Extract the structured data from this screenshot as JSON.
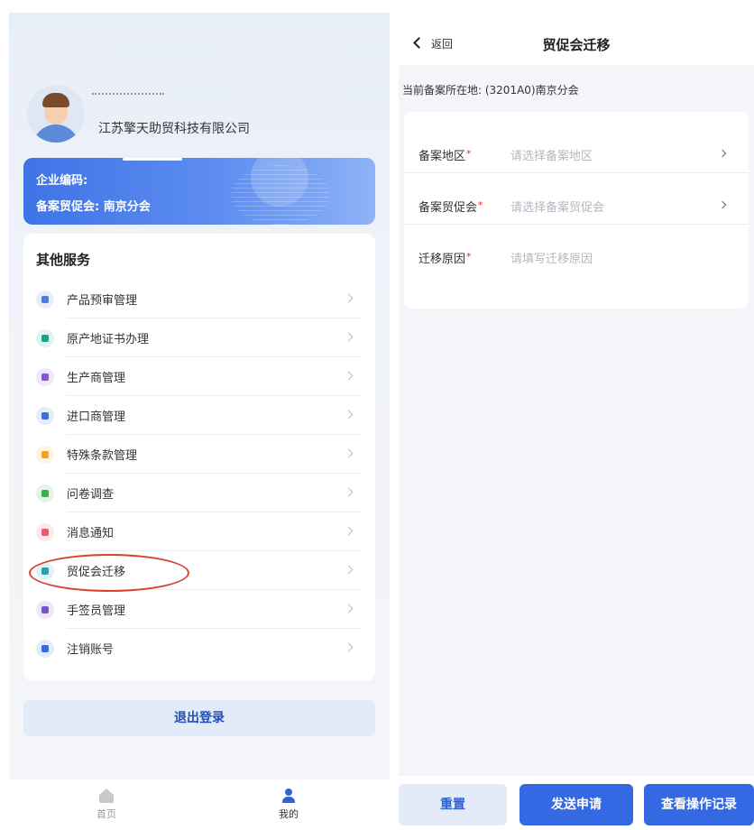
{
  "left": {
    "company_name": "江苏擎天助贸科技有限公司",
    "enterprise_card": {
      "code_label": "企业编码:",
      "coc_label": "备案贸促会: 南京分会"
    },
    "services": {
      "title": "其他服务",
      "items": [
        {
          "label": "产品预审管理",
          "icon": "cart-icon",
          "color": "#4f7be0"
        },
        {
          "label": "原产地证书办理",
          "icon": "location-pin-icon",
          "color": "#1aa38c"
        },
        {
          "label": "生产商管理",
          "icon": "factory-icon",
          "color": "#8a52d6"
        },
        {
          "label": "进口商管理",
          "icon": "globe-icon",
          "color": "#3b6fd8"
        },
        {
          "label": "特殊条款管理",
          "icon": "triangle-icon",
          "color": "#f0a21a"
        },
        {
          "label": "问卷调查",
          "icon": "clipboard-icon",
          "color": "#3eb04a"
        },
        {
          "label": "消息通知",
          "icon": "bell-icon",
          "color": "#ee5a6c"
        },
        {
          "label": "贸促会迁移",
          "icon": "building-icon",
          "color": "#27a0b5"
        },
        {
          "label": "手签员管理",
          "icon": "signature-icon",
          "color": "#7654c9"
        },
        {
          "label": "注销账号",
          "icon": "power-icon",
          "color": "#3569e3"
        }
      ]
    },
    "logout_label": "退出登录",
    "nav": {
      "home_label": "首页",
      "mine_label": "我的"
    }
  },
  "right": {
    "back_label": "返回",
    "title": "贸促会迁移",
    "current_location": "当前备案所在地: (3201A0)南京分会",
    "form": {
      "rows": [
        {
          "label": "备案地区",
          "placeholder": "请选择备案地区",
          "has_chevron": true
        },
        {
          "label": "备案贸促会",
          "placeholder": "请选择备案贸促会",
          "has_chevron": true
        },
        {
          "label": "迁移原因",
          "placeholder": "请填写迁移原因",
          "has_chevron": false
        }
      ],
      "required_mark": "*"
    },
    "actions": {
      "reset": "重置",
      "submit": "发送申请",
      "view_log": "查看操作记录"
    }
  },
  "colors": {
    "primary": "#3569e3",
    "highlight_ellipse": "#d9412f",
    "required": "#e0302a"
  }
}
